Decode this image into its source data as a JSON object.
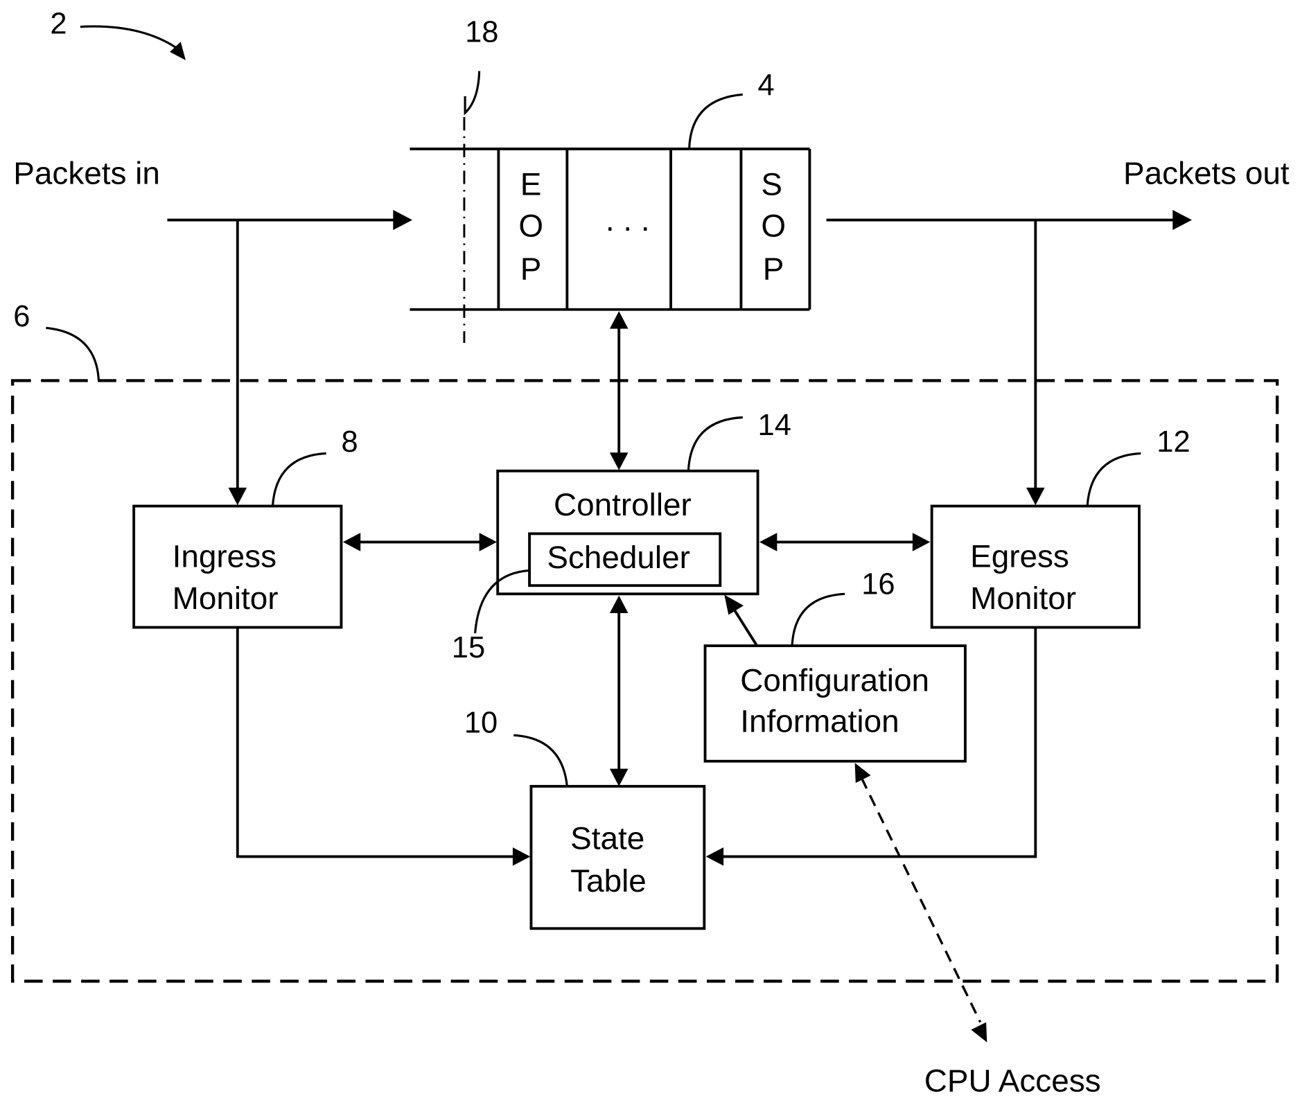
{
  "figure": {
    "ref_system": "2",
    "ref_buffer": "4",
    "ref_management_block": "6",
    "ref_ingress_monitor": "8",
    "ref_state_table": "10",
    "ref_egress_monitor": "12",
    "ref_controller": "14",
    "ref_scheduler": "15",
    "ref_configuration": "16",
    "ref_cut_line": "18"
  },
  "io": {
    "packets_in": "Packets in",
    "packets_out": "Packets out",
    "cpu_access": "CPU Access"
  },
  "buffer": {
    "eop_letters": [
      "E",
      "O",
      "P"
    ],
    "sop_letters": [
      "S",
      "O",
      "P"
    ],
    "ellipsis": ". . ."
  },
  "blocks": {
    "ingress_monitor": [
      "Ingress",
      "Monitor"
    ],
    "egress_monitor": [
      "Egress",
      "Monitor"
    ],
    "controller": "Controller",
    "scheduler": "Scheduler",
    "configuration": [
      "Configuration",
      "Information"
    ],
    "state_table": [
      "State",
      "Table"
    ]
  }
}
